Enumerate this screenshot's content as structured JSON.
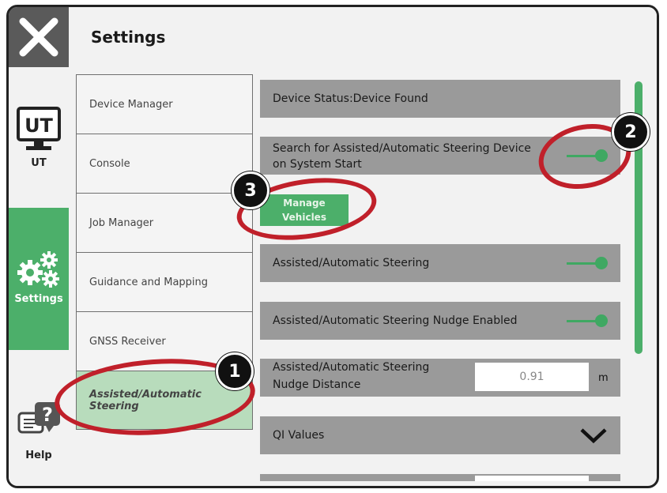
{
  "header": {
    "title": "Settings"
  },
  "leftnav": {
    "ut": {
      "icon_text": "UT",
      "label": "UT"
    },
    "settings": {
      "label": "Settings"
    },
    "help": {
      "label": "Help"
    }
  },
  "menu": {
    "items": [
      {
        "label": "Device Manager"
      },
      {
        "label": "Console"
      },
      {
        "label": "Job Manager"
      },
      {
        "label": "Guidance and Mapping"
      },
      {
        "label": "GNSS Receiver"
      },
      {
        "label": "Assisted/Automatic Steering"
      }
    ],
    "active_index": 5
  },
  "panel": {
    "device_status": "Device Status:Device Found",
    "search_on_start": {
      "label_line1": "Search for Assisted/Automatic Steering Device",
      "label_line2": "on System Start",
      "enabled": true
    },
    "manage_vehicles": {
      "line1": "Manage",
      "line2": "Vehicles"
    },
    "steering": {
      "label": "Assisted/Automatic Steering",
      "enabled": true
    },
    "nudge_enabled": {
      "label": "Assisted/Automatic Steering Nudge Enabled",
      "enabled": true
    },
    "nudge_distance": {
      "label_line1": "Assisted/Automatic Steering",
      "label_line2": "Nudge Distance",
      "value": "0.91",
      "unit": "m"
    },
    "qi_values": {
      "label": "QI Values"
    }
  },
  "annotations": {
    "badge1": "1",
    "badge2": "2",
    "badge3": "3"
  },
  "colors": {
    "accent": "#4caf6a",
    "annotation": "#c0202a",
    "row_bg": "#9a9a9a"
  }
}
